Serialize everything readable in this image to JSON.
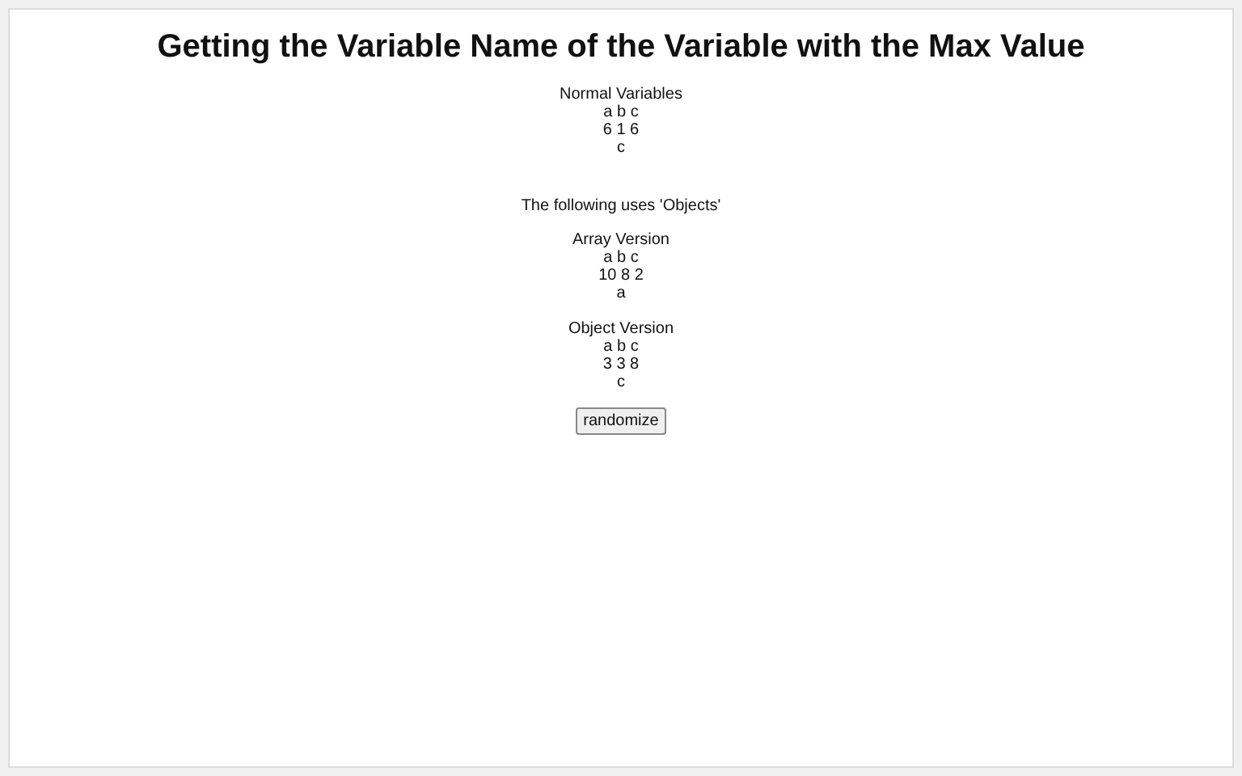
{
  "title": "Getting the Variable Name of the Variable with the Max Value",
  "sections": [
    {
      "heading": "Normal Variables",
      "names": "a b c",
      "values": "6 1 6",
      "result": "c"
    },
    {
      "note": "The following uses 'Objects'",
      "heading": "Array Version",
      "names": "a b c",
      "values": "10 8 2",
      "result": "a"
    },
    {
      "heading": "Object Version",
      "names": "a b c",
      "values": "3 3 8",
      "result": "c"
    }
  ],
  "button": "randomize"
}
